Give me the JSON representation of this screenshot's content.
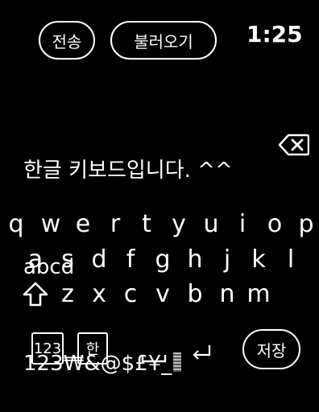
{
  "header": {
    "send_label": "전송",
    "load_label": "불러오기",
    "time": "1:25"
  },
  "editor": {
    "lines": [
      "한글 키보드입니다. ^^",
      "abcd",
      "123₩&@$£¥_"
    ]
  },
  "keyboard": {
    "row1": [
      "q",
      "w",
      "e",
      "r",
      "t",
      "y",
      "u",
      "i",
      "o",
      "p"
    ],
    "row2": [
      "a",
      "s",
      "d",
      "f",
      "g",
      "h",
      "j",
      "k",
      "l"
    ],
    "row3": [
      "z",
      "x",
      "c",
      "v",
      "b",
      "n",
      "m"
    ],
    "num_label": "123",
    "han_label": "한",
    "save_label": "저장",
    "icons": {
      "shift": "shift-icon",
      "backspace": "backspace-icon",
      "space": "space-icon",
      "return": "return-icon"
    }
  },
  "colors": {
    "background": "#000000",
    "foreground": "#ffffff"
  }
}
